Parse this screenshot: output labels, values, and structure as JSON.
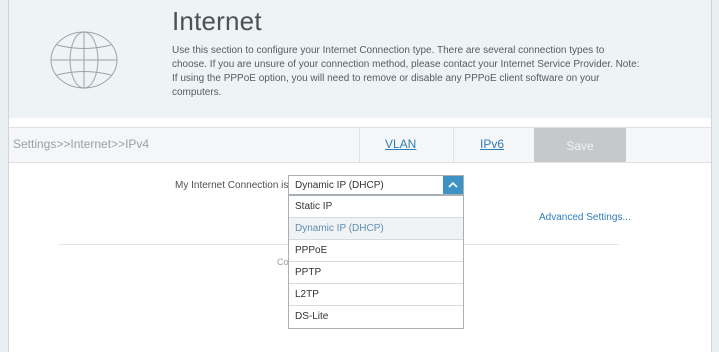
{
  "header": {
    "title": "Internet",
    "description": "Use this section to configure your Internet Connection type. There are several connection types to choose. If you are unsure of your connection method, please contact your Internet Service Provider. Note: If using the PPPoE option, you will need to remove or disable any PPPoE client software on your computers."
  },
  "toolbar": {
    "breadcrumb": "Settings>>Internet>>IPv4",
    "tabs": [
      {
        "label": "VLAN"
      },
      {
        "label": "IPv6"
      }
    ],
    "save_label": "Save"
  },
  "connection": {
    "label": "My Internet Connection is:",
    "selected": "Dynamic IP (DHCP)",
    "options": [
      "Static IP",
      "Dynamic IP (DHCP)",
      "PPPoE",
      "PPTP",
      "L2TP",
      "DS-Lite"
    ],
    "selected_index": 1
  },
  "advanced_link": "Advanced Settings...",
  "ghost_text": "Co",
  "colors": {
    "accent": "#3d94c4",
    "link": "#2f7fb8",
    "save_disabled": "#c6c8ca",
    "header_bg": "#eef3f6"
  },
  "icons": {
    "header": "globe-icon",
    "select": "chevron-up-icon"
  }
}
